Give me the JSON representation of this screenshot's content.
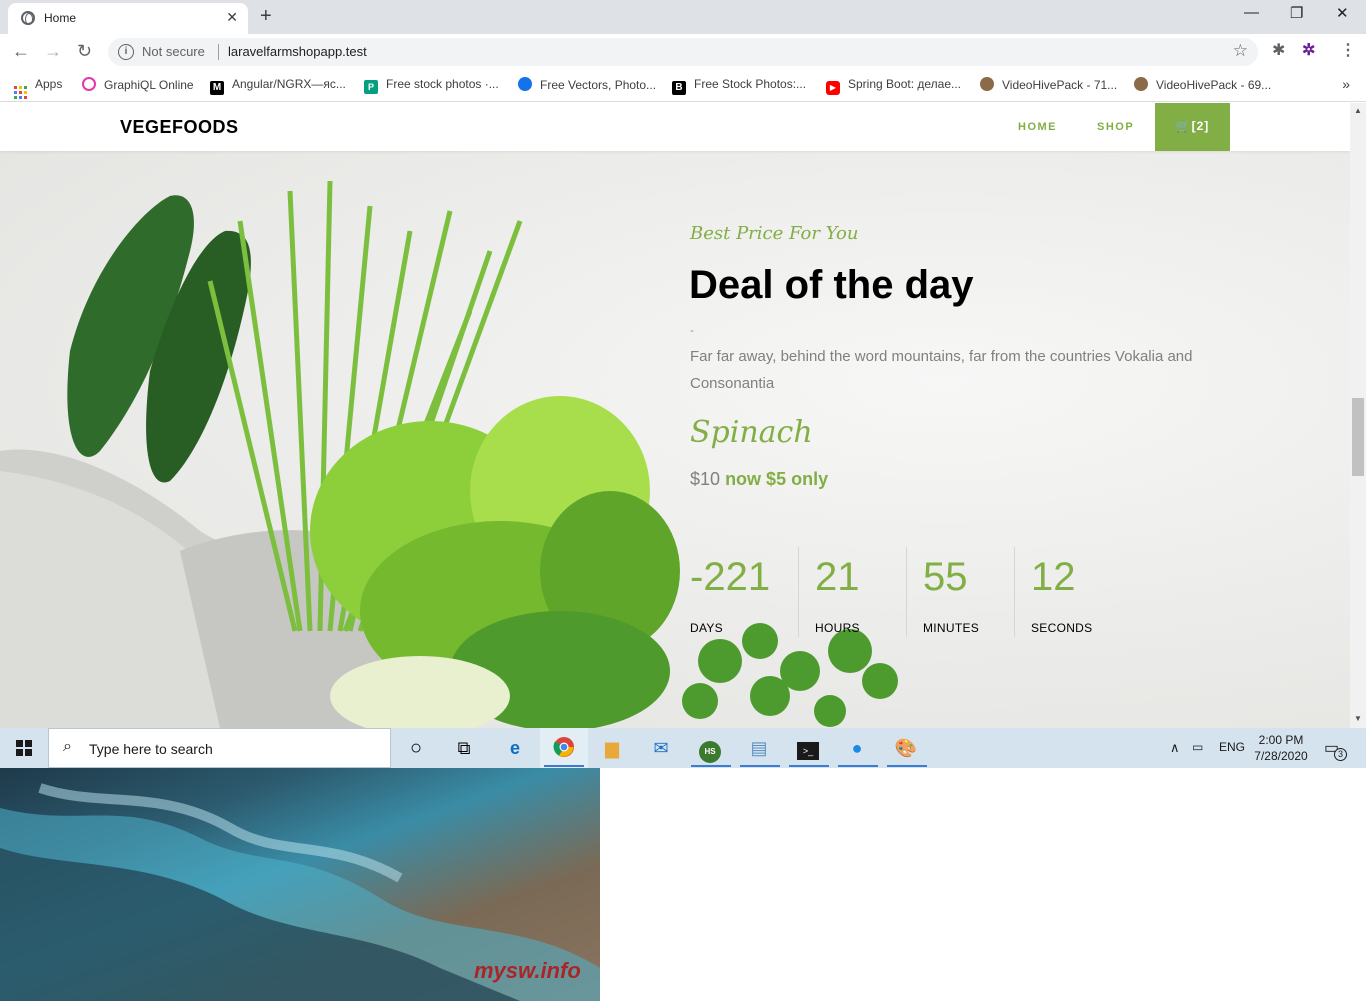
{
  "browser": {
    "tab_title": "Home",
    "not_secure_label": "Not secure",
    "url": "laravelfarmshopapp.test"
  },
  "bookmarks": [
    {
      "label": "Apps",
      "icon": "apps-grid-icon"
    },
    {
      "label": "GraphiQL Online",
      "icon": "graphql-icon",
      "color": "#e535ab"
    },
    {
      "label": "Angular/NGRX—яс...",
      "icon": "medium-icon",
      "color": "#000000"
    },
    {
      "label": "Free stock photos ·...",
      "icon": "pexels-icon",
      "color": "#05a081"
    },
    {
      "label": "Free Vectors, Photo...",
      "icon": "freepik-icon",
      "color": "#1273eb"
    },
    {
      "label": "Free Stock Photos:...",
      "icon": "burst-icon",
      "color": "#000000"
    },
    {
      "label": "Spring Boot: делае...",
      "icon": "youtube-icon",
      "color": "#ff0000"
    },
    {
      "label": "VideoHivePack - 71...",
      "icon": "videohive-icon",
      "color": "#6b4a2a"
    },
    {
      "label": "VideoHivePack - 69...",
      "icon": "videohive-icon",
      "color": "#6b4a2a"
    }
  ],
  "site": {
    "brand": "VEGEFOODS",
    "nav": [
      "HOME",
      "SHOP"
    ],
    "cart_label": "[2]",
    "accent_color": "#82ae46"
  },
  "deal": {
    "subheading": "Best Price For You",
    "headline": "Deal of the day",
    "dash": "-",
    "description": "Far far away, behind the word mountains, far from the countries Vokalia and Consonantia",
    "product": "Spinach",
    "price_old": "$10",
    "price_new": "now $5 only",
    "countdown": [
      {
        "value": "-221",
        "label": "DAYS"
      },
      {
        "value": "21",
        "label": "HOURS"
      },
      {
        "value": "55",
        "label": "MINUTES"
      },
      {
        "value": "12",
        "label": "SECONDS"
      }
    ]
  },
  "taskbar": {
    "search_placeholder": "Type here to search",
    "language": "ENG",
    "time": "2:00 PM",
    "date": "7/28/2020",
    "notification_count": "3"
  },
  "wallpaper": {
    "watermark": "mysw.info"
  }
}
